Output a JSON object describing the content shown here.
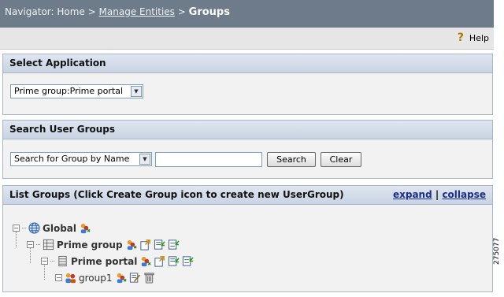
{
  "navigator": {
    "prefix": "Navigator:",
    "home": "Home",
    "sep1": ">",
    "manage": "Manage Entities",
    "sep2": ">",
    "current": "Groups"
  },
  "help": {
    "label": "Help"
  },
  "select_app": {
    "title": "Select Application",
    "value": "Prime group:Prime portal"
  },
  "search": {
    "title": "Search User Groups",
    "mode": "Search for Group by Name",
    "query": "",
    "search_button": "Search",
    "clear_button": "Clear"
  },
  "list": {
    "title": "List Groups (Click Create Group icon to create new UserGroup)",
    "expand": "expand",
    "separator": "|",
    "collapse": "collapse",
    "tree": [
      {
        "label": "Global",
        "icon": "globe-icon",
        "actions": [
          "create-group-icon"
        ]
      },
      {
        "label": "Prime group",
        "icon": "grid-icon",
        "actions": [
          "create-group-icon",
          "export-icon",
          "import-icon",
          "import-alt-icon"
        ]
      },
      {
        "label": "Prime portal",
        "icon": "portal-icon",
        "actions": [
          "create-group-icon",
          "export-icon",
          "import-icon",
          "import-alt-icon"
        ]
      },
      {
        "label": "group1",
        "icon": "users-icon",
        "actions": [
          "create-group-icon",
          "edit-icon",
          "delete-icon"
        ]
      }
    ]
  },
  "figure_id": "275077"
}
